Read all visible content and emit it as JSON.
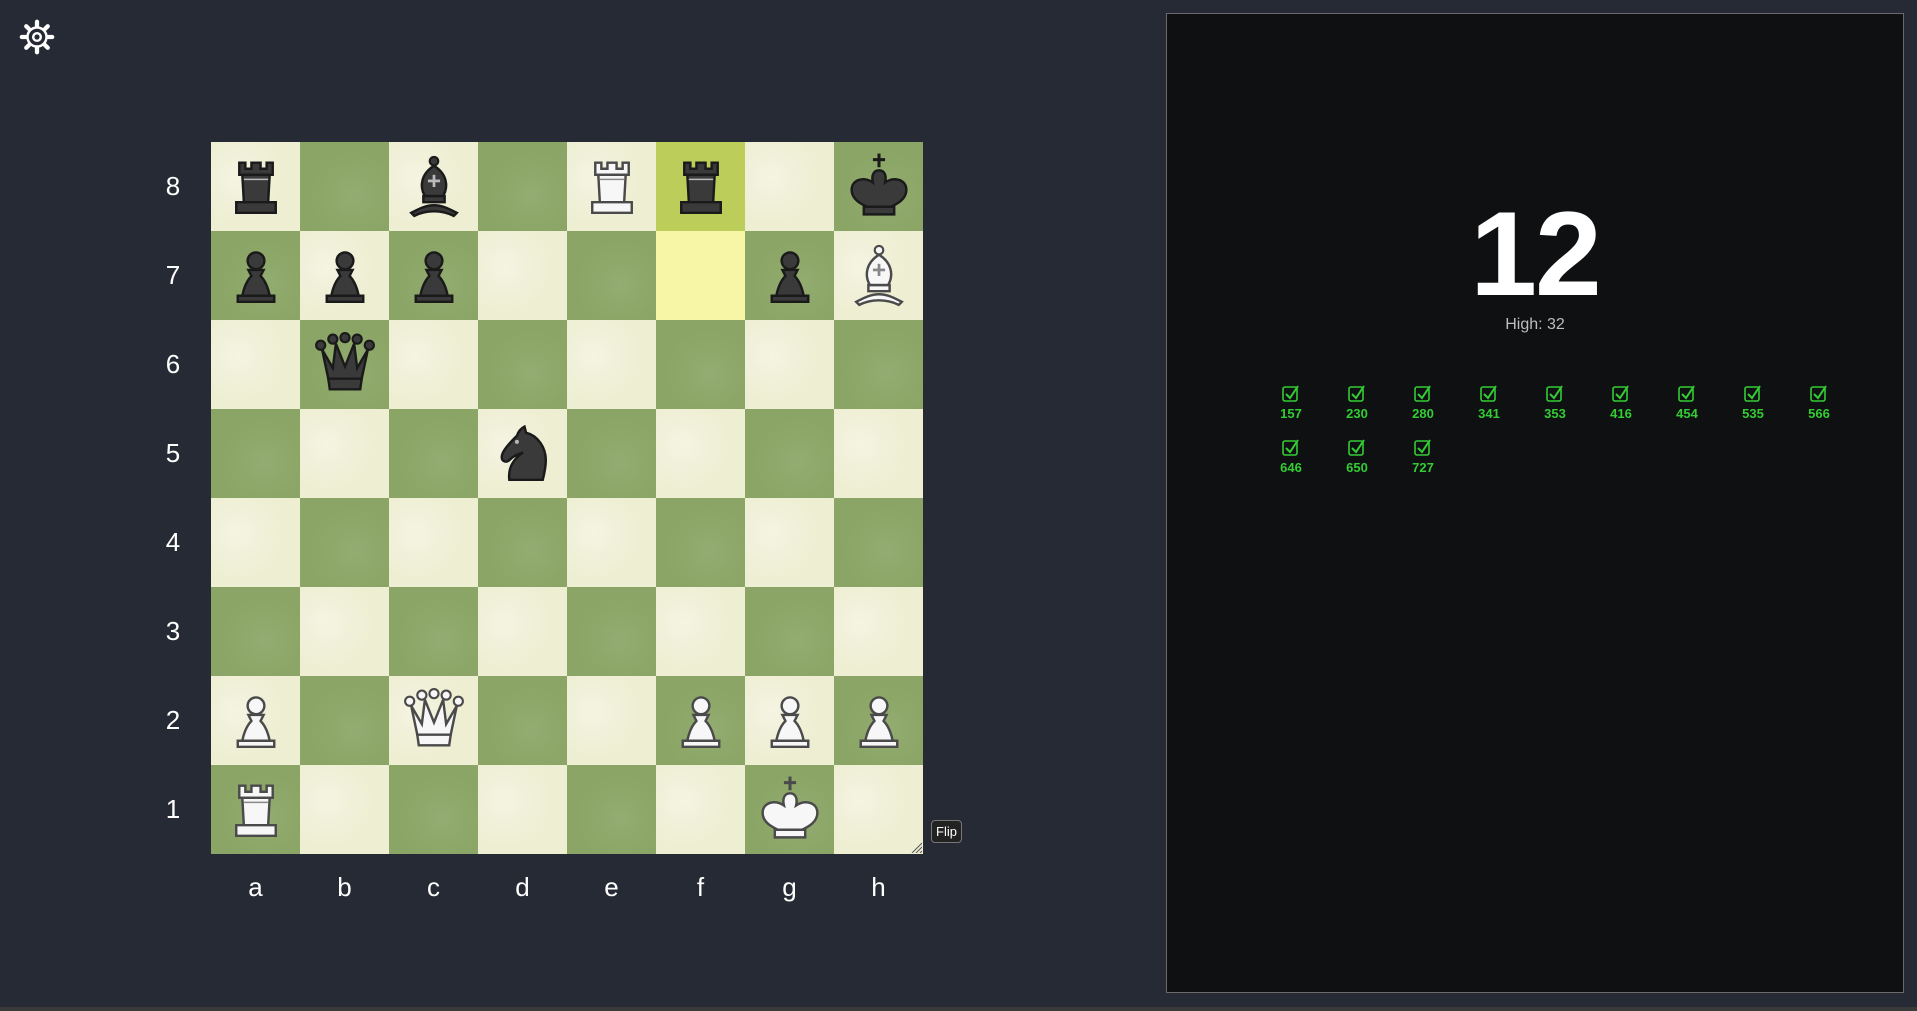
{
  "board": {
    "ranks": [
      "8",
      "7",
      "6",
      "5",
      "4",
      "3",
      "2",
      "1"
    ],
    "files": [
      "a",
      "b",
      "c",
      "d",
      "e",
      "f",
      "g",
      "h"
    ],
    "highlighted": [
      "f8",
      "f7"
    ],
    "pieces": {
      "a8": "bR",
      "c8": "bB",
      "e8": "wR",
      "f8": "bR",
      "h8": "bK",
      "a7": "bP",
      "b7": "bP",
      "c7": "bP",
      "g7": "bP",
      "h7": "wB",
      "b6": "bQ",
      "d5": "bN",
      "a2": "wP",
      "c2": "wQ",
      "f2": "wP",
      "g2": "wP",
      "h2": "wP",
      "a1": "wR",
      "g1": "wK"
    },
    "colors": {
      "light": "#eeeed2",
      "dark": "#8aa565",
      "hl_light": "#f6f6a6",
      "hl_dark": "#bccd5a"
    }
  },
  "controls": {
    "flip_label": "Flip"
  },
  "score": {
    "current": "12",
    "high_label": "High: 32"
  },
  "history": [
    "157",
    "230",
    "280",
    "341",
    "353",
    "416",
    "454",
    "535",
    "566",
    "646",
    "650",
    "727"
  ],
  "colors": {
    "accent_green": "#33cc33",
    "background": "#262a35",
    "panel": "#0f1012"
  }
}
